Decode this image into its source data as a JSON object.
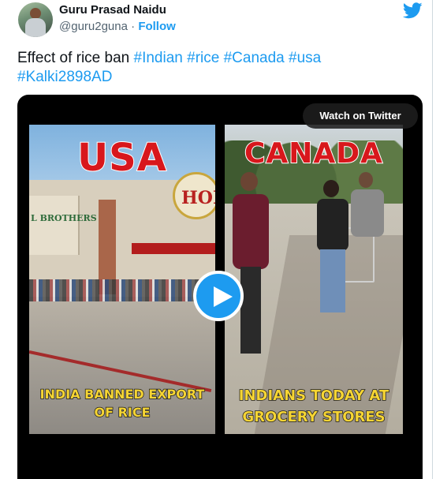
{
  "author": {
    "display_name": "Guru Prasad Naidu",
    "handle": "@guru2guna",
    "separator": "·",
    "follow_label": "Follow"
  },
  "icons": {
    "brand": "twitter-bird-icon",
    "play": "play-icon"
  },
  "colors": {
    "accent": "#1d9bf0",
    "text": "#0f1419",
    "secondary": "#536471"
  },
  "tweet": {
    "text": "Effect of rice ban",
    "hashtags": [
      "#Indian",
      "#rice",
      "#Canada",
      "#usa",
      "#Kalki2898AD"
    ]
  },
  "media": {
    "watch_label": "Watch on Twitter",
    "left_panel": {
      "title": "USA",
      "caption_line1": "INDIA BANNED EXPORT",
      "caption_line2": "OF RICE",
      "store_sign": "HON",
      "store_brand": "L BROTHERS"
    },
    "right_panel": {
      "title": "CANADA",
      "caption_line1": "INDIANS TODAY AT",
      "caption_line2": "GROCERY STORES"
    }
  }
}
